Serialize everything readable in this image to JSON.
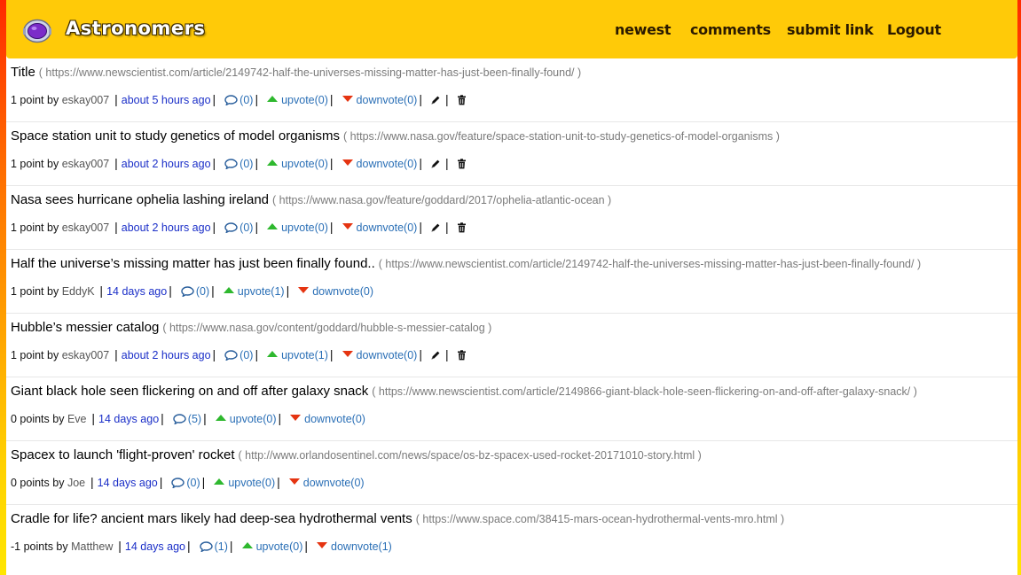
{
  "header": {
    "brand": "Astronomers",
    "nav": [
      "newest",
      "comments",
      "submit link",
      "Logout"
    ]
  },
  "colors": {
    "header_bg": "#ffca08",
    "upvote": "#2eb82e",
    "downvote": "#e53411",
    "link": "#2a6fb6",
    "time_link": "#1b2fc8"
  },
  "icons": [
    "comment-icon",
    "upvote-arrow-icon",
    "downvote-arrow-icon",
    "edit-pencil-icon",
    "delete-trash-icon"
  ],
  "posts": [
    {
      "title": "Title",
      "url": "( https://www.newscientist.com/article/2149742-half-the-universes-missing-matter-has-just-been-finally-found/ )",
      "points": "1 point by",
      "user": "eskay007",
      "time": "about 5 hours ago",
      "comments": "(0)",
      "upvote": "upvote(0)",
      "downvote": "downvote(0)",
      "editable": true
    },
    {
      "title": "Space station unit to study genetics of model organisms",
      "url": "( https://www.nasa.gov/feature/space-station-unit-to-study-genetics-of-model-organisms )",
      "points": "1 point by",
      "user": "eskay007",
      "time": "about 2 hours ago",
      "comments": "(0)",
      "upvote": "upvote(0)",
      "downvote": "downvote(0)",
      "editable": true
    },
    {
      "title": "Nasa sees hurricane ophelia lashing ireland",
      "url": "( https://www.nasa.gov/feature/goddard/2017/ophelia-atlantic-ocean )",
      "points": "1 point by",
      "user": "eskay007",
      "time": "about 2 hours ago",
      "comments": "(0)",
      "upvote": "upvote(0)",
      "downvote": "downvote(0)",
      "editable": true
    },
    {
      "title": "Half the universe’s missing matter has just been finally found..",
      "url": "( https://www.newscientist.com/article/2149742-half-the-universes-missing-matter-has-just-been-finally-found/ )",
      "points": "1 point by",
      "user": "EddyK",
      "time": "14 days ago",
      "comments": "(0)",
      "upvote": "upvote(1)",
      "downvote": "downvote(0)",
      "editable": false
    },
    {
      "title": "Hubble’s messier catalog",
      "url": "( https://www.nasa.gov/content/goddard/hubble-s-messier-catalog )",
      "points": "1 point by",
      "user": "eskay007",
      "time": "about 2 hours ago",
      "comments": "(0)",
      "upvote": "upvote(1)",
      "downvote": "downvote(0)",
      "editable": true
    },
    {
      "title": "Giant black hole seen flickering on and off after galaxy snack",
      "url": "( https://www.newscientist.com/article/2149866-giant-black-hole-seen-flickering-on-and-off-after-galaxy-snack/ )",
      "points": "0 points by",
      "user": "Eve",
      "time": "14 days ago",
      "comments": "(5)",
      "upvote": "upvote(0)",
      "downvote": "downvote(0)",
      "editable": false
    },
    {
      "title": "Spacex to launch 'flight-proven' rocket",
      "url": "( http://www.orlandosentinel.com/news/space/os-bz-spacex-used-rocket-20171010-story.html )",
      "points": "0 points by",
      "user": "Joe",
      "time": "14 days ago",
      "comments": "(0)",
      "upvote": "upvote(0)",
      "downvote": "downvote(0)",
      "editable": false
    },
    {
      "title": "Cradle for life? ancient mars likely had deep-sea hydrothermal vents",
      "url": "( https://www.space.com/38415-mars-ocean-hydrothermal-vents-mro.html )",
      "points": "-1 points by",
      "user": "Matthew",
      "time": "14 days ago",
      "comments": "(1)",
      "upvote": "upvote(0)",
      "downvote": "downvote(1)",
      "editable": false
    }
  ]
}
